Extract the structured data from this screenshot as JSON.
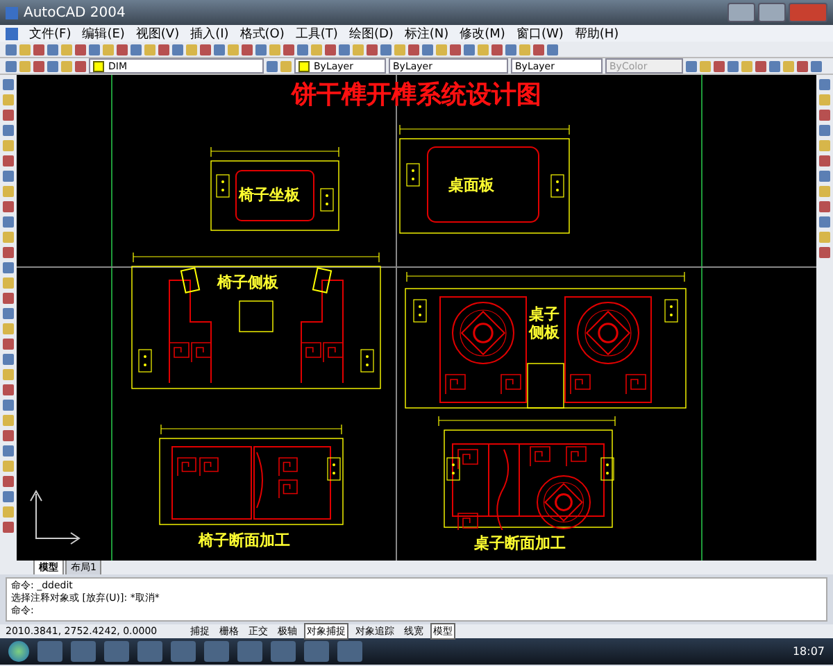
{
  "window": {
    "title": "AutoCAD 2004"
  },
  "menu": [
    "文件(F)",
    "编辑(E)",
    "视图(V)",
    "插入(I)",
    "格式(O)",
    "工具(T)",
    "绘图(D)",
    "标注(N)",
    "修改(M)",
    "窗口(W)",
    "帮助(H)"
  ],
  "properties": {
    "layer": "DIM",
    "color_control": "ByLayer",
    "linetype": "ByLayer",
    "lineweight": "ByLayer",
    "plot_style": {
      "value": "ByColor",
      "disabled": true
    }
  },
  "drawing": {
    "title": "饼干榫开榫系统设计图",
    "parts": [
      {
        "kind": "chair-seat",
        "label": "椅子坐板"
      },
      {
        "kind": "table-top",
        "label": "桌面板"
      },
      {
        "kind": "chair-side",
        "label": "椅子侧板"
      },
      {
        "kind": "table-side",
        "label": "桌子侧板"
      },
      {
        "kind": "chair-section",
        "label": "椅子断面加工"
      },
      {
        "kind": "table-section",
        "label": "桌子断面加工"
      }
    ]
  },
  "tabs": [
    {
      "label": "模型",
      "selected": true
    },
    {
      "label": "布局1",
      "selected": false
    }
  ],
  "command_lines": [
    "命令: _ddedit",
    "选择注释对象或 [放弃(U)]:  *取消*",
    "命令:"
  ],
  "coordinates": "2010.3841, 2752.4242, 0.0000",
  "status_buttons": [
    {
      "label": "捕捉",
      "on": false
    },
    {
      "label": "栅格",
      "on": false
    },
    {
      "label": "正交",
      "on": false
    },
    {
      "label": "极轴",
      "on": false
    },
    {
      "label": "对象捕捉",
      "on": true
    },
    {
      "label": "对象追踪",
      "on": false
    },
    {
      "label": "线宽",
      "on": false
    },
    {
      "label": "模型",
      "on": true
    }
  ],
  "taskbar": {
    "clock": "18:07"
  }
}
